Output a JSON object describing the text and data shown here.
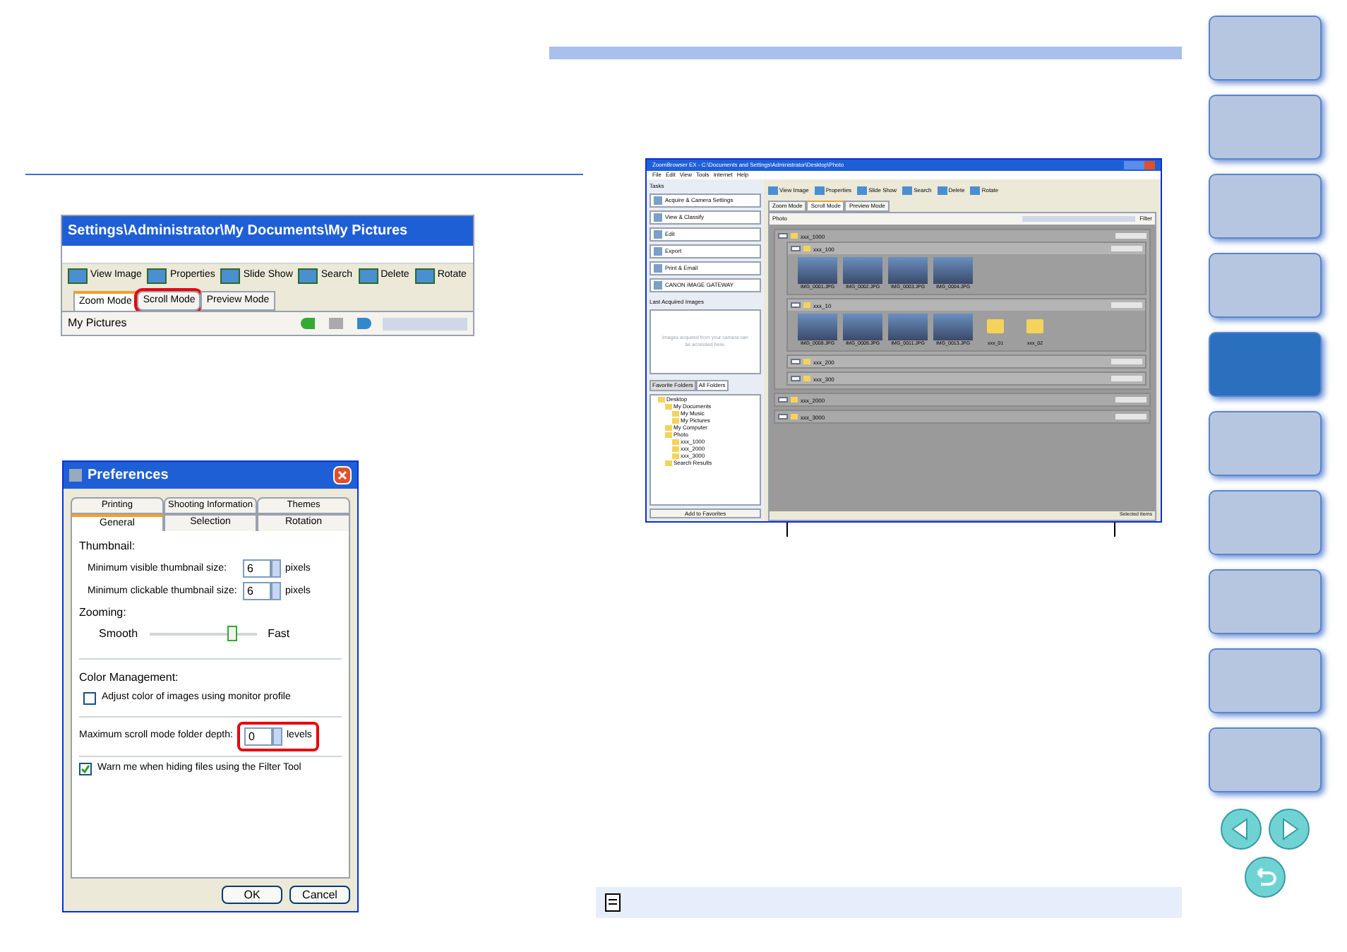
{
  "screenshot_1": {
    "title": "Settings\\Administrator\\My Documents\\My Pictures",
    "toolbar": [
      "View Image",
      "Properties",
      "Slide Show",
      "Search",
      "Delete",
      "Rotate"
    ],
    "tabs": [
      {
        "label": "Zoom Mode",
        "selected": true,
        "highlighted": false
      },
      {
        "label": "Scroll Mode",
        "selected": false,
        "highlighted": true
      },
      {
        "label": "Preview Mode",
        "selected": false,
        "highlighted": false
      }
    ],
    "panel_title": "My Pictures"
  },
  "preferences": {
    "title": "Preferences",
    "tabs_back": [
      {
        "label": "Printing",
        "selected": false
      },
      {
        "label": "Shooting Information",
        "selected": false
      },
      {
        "label": "Themes",
        "selected": false
      }
    ],
    "tabs_front": [
      {
        "label": "General",
        "selected": true
      },
      {
        "label": "Selection",
        "selected": false
      },
      {
        "label": "Rotation",
        "selected": false
      }
    ],
    "thumbnail": {
      "heading": "Thumbnail:",
      "rows": [
        {
          "label": "Minimum visible thumbnail size:",
          "value": "6",
          "unit": "pixels"
        },
        {
          "label": "Minimum clickable thumbnail size:",
          "value": "6",
          "unit": "pixels"
        }
      ]
    },
    "zooming": {
      "heading": "Zooming:",
      "left": "Smooth",
      "right": "Fast",
      "level": 0.78
    },
    "color_management": {
      "heading": "Color Management:",
      "label": "Adjust color of images using monitor profile",
      "checked": false
    },
    "depth": {
      "label": "Maximum scroll mode folder depth:",
      "value": "0",
      "unit": "levels"
    },
    "warn": {
      "label": "Warn me when hiding files using the Filter Tool",
      "checked": true
    },
    "buttons": [
      "OK",
      "Cancel"
    ]
  },
  "screenshot_2": {
    "title": "ZoomBrowser EX - C:\\Documents and Settings\\Administrator\\Desktop\\Photo",
    "menu": [
      "File",
      "Edit",
      "View",
      "Tools",
      "Internet",
      "Help"
    ],
    "tasks_title": "Tasks",
    "tasks": [
      "Acquire & Camera Settings",
      "View & Classify",
      "Edit",
      "Export",
      "Print & Email",
      "CANON iMAGE GATEWAY"
    ],
    "last_acquired": {
      "title": "Last Acquired Images",
      "text": "Images acquired from your camera can be accessed here."
    },
    "folder_tabs": [
      {
        "label": "Favorite Folders",
        "selected": false
      },
      {
        "label": "All Folders",
        "selected": true
      }
    ],
    "tree": [
      {
        "label": "Desktop",
        "children": [
          {
            "label": "My Documents",
            "children": [
              {
                "label": "My Music"
              },
              {
                "label": "My Pictures"
              }
            ]
          },
          {
            "label": "My Computer"
          },
          {
            "label": "Photo",
            "children": [
              {
                "label": "xxx_1000"
              },
              {
                "label": "xxx_2000"
              },
              {
                "label": "xxx_3000"
              }
            ]
          },
          {
            "label": "Search Results"
          }
        ]
      }
    ],
    "add_button": "Add to Favorites",
    "toolbar": [
      "View Image",
      "Properties",
      "Slide Show",
      "Search",
      "Delete",
      "Rotate"
    ],
    "tabs": [
      {
        "label": "Zoom Mode",
        "selected": false
      },
      {
        "label": "Scroll Mode",
        "selected": true
      },
      {
        "label": "Preview Mode",
        "selected": false
      }
    ],
    "panel_title": "Photo",
    "filter": "Filter",
    "folders": [
      {
        "name": "xxx_1000",
        "children": [
          {
            "name": "xxx_100",
            "images": [
              "IMG_0001.JPG",
              "IMG_0002.JPG",
              "IMG_0003.JPG",
              "IMG_0004.JPG"
            ]
          },
          {
            "name": "xxx_10",
            "images": [
              "IMG_0008.JPG",
              "IMG_0009.JPG",
              "IMG_0011.JPG",
              "IMG_0013.JPG"
            ],
            "subfolders": [
              "xxx_01",
              "xxx_02"
            ]
          },
          {
            "name": "xxx_200"
          },
          {
            "name": "xxx_300"
          }
        ]
      },
      {
        "name": "xxx_2000"
      },
      {
        "name": "xxx_3000"
      }
    ],
    "status": "Selected Items"
  }
}
